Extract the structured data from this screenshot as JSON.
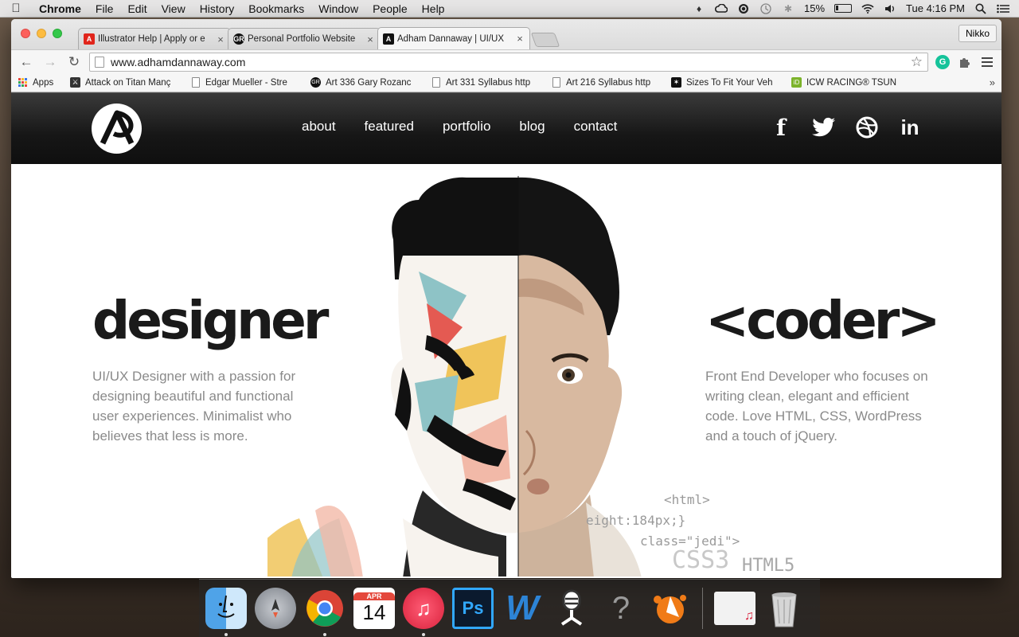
{
  "menubar": {
    "app": "Chrome",
    "items": [
      "File",
      "Edit",
      "View",
      "History",
      "Bookmarks",
      "Window",
      "People",
      "Help"
    ],
    "battery_percent": "15%",
    "clock": "Tue 4:16 PM"
  },
  "browser": {
    "profile": "Nikko",
    "tabs": [
      {
        "title": "Illustrator Help | Apply or e",
        "icon": "adobe-icon",
        "active": false
      },
      {
        "title": "Personal Portfolio Website",
        "icon": "gr-icon",
        "active": false
      },
      {
        "title": "Adham Dannaway | UI/UX",
        "icon": "ad-logo-icon",
        "active": true
      }
    ],
    "url": "www.adhamdannaway.com",
    "bookmarks": [
      {
        "label": "Apps",
        "icon": "apps-grid-icon"
      },
      {
        "label": "Attack on Titan Manç",
        "icon": "titan-icon"
      },
      {
        "label": "Edgar Mueller - Stre",
        "icon": "doc-icon"
      },
      {
        "label": "Art 336 Gary Rozanc",
        "icon": "gr-icon"
      },
      {
        "label": "Art 331 Syllabus http",
        "icon": "doc-icon"
      },
      {
        "label": "Art 216 Syllabus http",
        "icon": "doc-icon"
      },
      {
        "label": "Sizes To Fit Your Veh",
        "icon": "feather-icon"
      },
      {
        "label": "ICW RACING® TSUN",
        "icon": "id-icon"
      }
    ],
    "bookmarks_more": "»"
  },
  "site": {
    "nav": [
      "about",
      "featured",
      "portfolio",
      "blog",
      "contact"
    ],
    "social": [
      "facebook",
      "twitter",
      "dribbble",
      "linkedin"
    ],
    "social_glyphs": {
      "facebook": "f",
      "linkedin": "in"
    },
    "designer": {
      "heading": "designer",
      "text": "UI/UX Designer with a passion for designing beautiful and functional user experiences. Minimalist who believes that less is more."
    },
    "coder": {
      "heading": "<coder>",
      "text": "Front End Developer who focuses on writing clean, elegant and efficient code. Love HTML, CSS, WordPress and a touch of jQuery."
    },
    "code_snippets": [
      "<html>",
      "eight:184px;}",
      "class=\"jedi\">",
      "CSS3",
      "HTML5"
    ]
  },
  "dock": {
    "items": [
      {
        "name": "finder",
        "running": true
      },
      {
        "name": "launchpad",
        "running": false
      },
      {
        "name": "chrome",
        "running": true
      },
      {
        "name": "calendar",
        "month": "APR",
        "day": "14",
        "running": false
      },
      {
        "name": "itunes",
        "running": true
      },
      {
        "name": "photoshop",
        "label": "Ps",
        "running": false
      },
      {
        "name": "word",
        "label": "W",
        "running": false
      },
      {
        "name": "podcast",
        "running": false
      },
      {
        "name": "unknown-app",
        "label": "?",
        "running": false
      },
      {
        "name": "avast",
        "running": false
      },
      {
        "name": "itunes-window-preview",
        "running": false
      },
      {
        "name": "trash",
        "running": false
      }
    ]
  }
}
